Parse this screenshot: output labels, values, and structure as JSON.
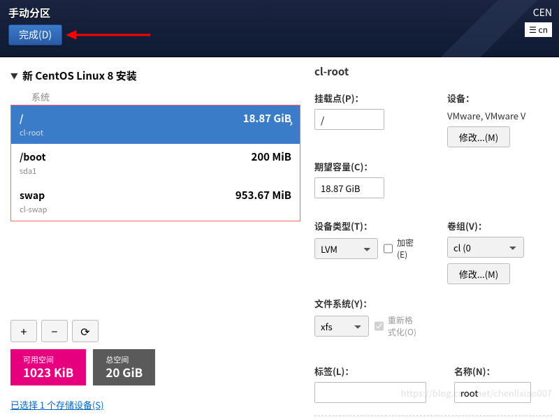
{
  "topbar": {
    "title": "手动分区",
    "done_label": "完成(D)",
    "distro": "CEN",
    "lang": "cn"
  },
  "left": {
    "install_title": "新 CentOS Linux 8 安装",
    "section_label": "系统",
    "partitions": [
      {
        "mount": "/",
        "size": "18.87 GiB",
        "dev": "cl-root",
        "selected": true
      },
      {
        "mount": "/boot",
        "size": "200 MiB",
        "dev": "sda1",
        "selected": false
      },
      {
        "mount": "swap",
        "size": "953.67 MiB",
        "dev": "cl-swap",
        "selected": false
      }
    ],
    "add_label": "+",
    "remove_label": "−",
    "reload_label": "⟳",
    "available_label": "可用空间",
    "available_value": "1023 KiB",
    "total_label": "总空间",
    "total_value": "20 GiB",
    "link_text": "已选择 1 个存储设备(S)"
  },
  "right": {
    "title": "cl-root",
    "mount_label": "挂载点(P)：",
    "mount_value": "/",
    "device_label": "设备：",
    "device_value": "VMware, VMware V",
    "modify1_label": "修改...(M)",
    "capacity_label": "期望容量(C)：",
    "capacity_value": "18.87 GiB",
    "devtype_label": "设备类型(T)：",
    "devtype_value": "LVM",
    "encrypt_label": "加密(E)",
    "vg_label": "卷组(V)：",
    "vg_value": "cl",
    "vg_extra": "(0",
    "modify2_label": "修改...(M)",
    "fs_label": "文件系统(Y)：",
    "fs_value": "xfs",
    "reformat_label": "重新格式化(O)",
    "tag_label": "标签(L)：",
    "name_label": "名称(N)：",
    "name_value": "root"
  },
  "watermark": "https://blog.csdn.net/chenlixiao007"
}
